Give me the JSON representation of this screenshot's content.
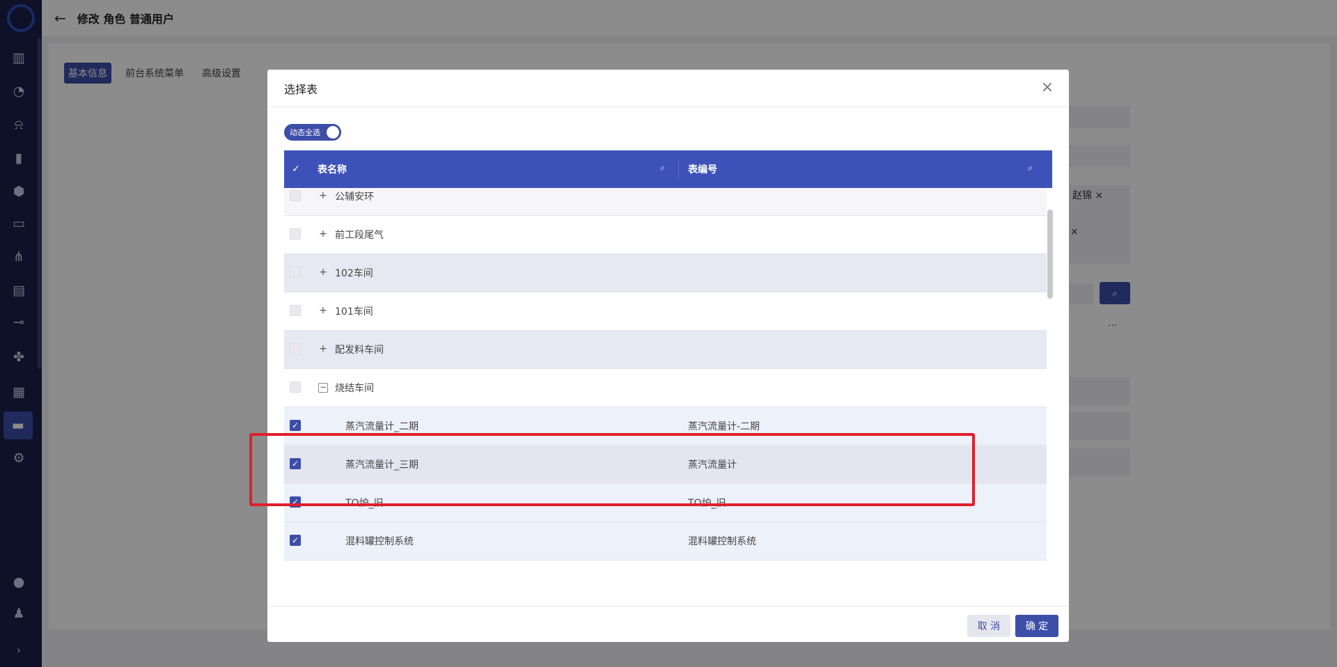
{
  "header": {
    "title": "修改 角色 普通用户"
  },
  "background": {
    "tabs": [
      {
        "label": "基本信息",
        "active": true
      },
      {
        "label": "前台系统菜单",
        "active": false
      },
      {
        "label": "高级设置",
        "active": false
      }
    ],
    "chips": [
      "赵锦 ×",
      "×"
    ],
    "more": "..."
  },
  "sidebar": {
    "icons": [
      "dashboard-icon",
      "gauge-icon",
      "alarm-icon",
      "bar-chart-icon",
      "ai-icon",
      "monitor-icon",
      "flow-icon",
      "code-icon",
      "pipe-icon",
      "apps-icon",
      "report-icon",
      "archive-icon",
      "settings-icon",
      "chat-icon",
      "user-icon"
    ]
  },
  "modal": {
    "title": "选择表",
    "toggle_label": "动态全选",
    "columns": [
      "表名称",
      "表编号"
    ],
    "rows": [
      {
        "name": "公辅安环",
        "code": "",
        "checked": false,
        "expander": "+",
        "indent": 0
      },
      {
        "name": "前工段尾气",
        "code": "",
        "checked": false,
        "expander": "+",
        "indent": 0
      },
      {
        "name": "102车间",
        "code": "",
        "checked": false,
        "expander": "+",
        "indent": 0
      },
      {
        "name": "101车间",
        "code": "",
        "checked": false,
        "expander": "+",
        "indent": 0
      },
      {
        "name": "配发料车间",
        "code": "",
        "checked": false,
        "expander": "+",
        "indent": 0
      },
      {
        "name": "烧结车间",
        "code": "",
        "checked": false,
        "expander": "−",
        "indent": 0
      },
      {
        "name": "蒸汽流量计_二期",
        "code": "蒸汽流量计-二期",
        "checked": true,
        "expander": "",
        "indent": 1
      },
      {
        "name": "蒸汽流量计_三期",
        "code": "蒸汽流量计",
        "checked": true,
        "expander": "",
        "indent": 1
      },
      {
        "name": "TO炉_旧",
        "code": "TO炉_旧",
        "checked": true,
        "expander": "",
        "indent": 1
      },
      {
        "name": "混料罐控制系统",
        "code": "混料罐控制系统",
        "checked": true,
        "expander": "",
        "indent": 1
      }
    ],
    "cancel_label": "取 消",
    "ok_label": "确 定"
  },
  "colors": {
    "primary": "#3d4ea8",
    "header": "#3d52b8",
    "highlight": "#e01f2b",
    "sidebar": "#1b1f4a"
  }
}
